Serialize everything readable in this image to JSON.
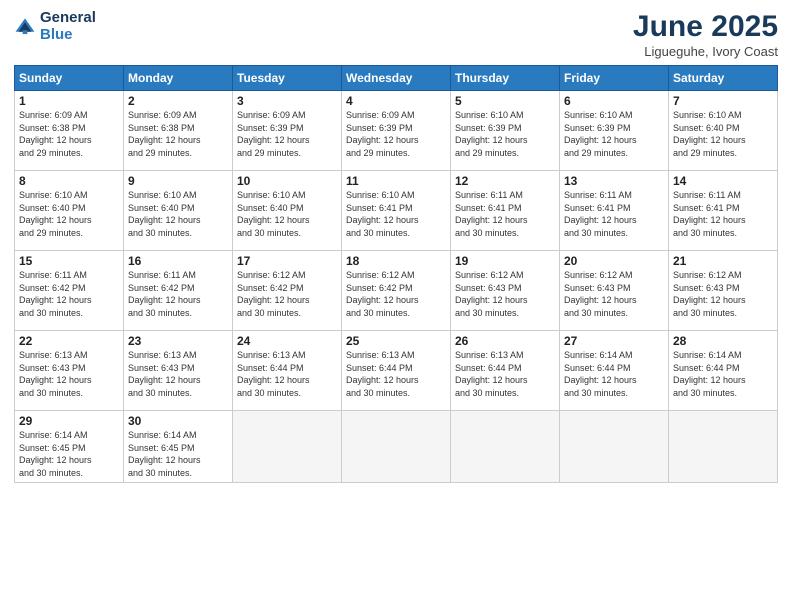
{
  "logo": {
    "line1": "General",
    "line2": "Blue"
  },
  "title": "June 2025",
  "subtitle": "Ligueguhe, Ivory Coast",
  "days_header": [
    "Sunday",
    "Monday",
    "Tuesday",
    "Wednesday",
    "Thursday",
    "Friday",
    "Saturday"
  ],
  "weeks": [
    [
      {
        "day": "1",
        "info": "Sunrise: 6:09 AM\nSunset: 6:38 PM\nDaylight: 12 hours\nand 29 minutes."
      },
      {
        "day": "2",
        "info": "Sunrise: 6:09 AM\nSunset: 6:38 PM\nDaylight: 12 hours\nand 29 minutes."
      },
      {
        "day": "3",
        "info": "Sunrise: 6:09 AM\nSunset: 6:39 PM\nDaylight: 12 hours\nand 29 minutes."
      },
      {
        "day": "4",
        "info": "Sunrise: 6:09 AM\nSunset: 6:39 PM\nDaylight: 12 hours\nand 29 minutes."
      },
      {
        "day": "5",
        "info": "Sunrise: 6:10 AM\nSunset: 6:39 PM\nDaylight: 12 hours\nand 29 minutes."
      },
      {
        "day": "6",
        "info": "Sunrise: 6:10 AM\nSunset: 6:39 PM\nDaylight: 12 hours\nand 29 minutes."
      },
      {
        "day": "7",
        "info": "Sunrise: 6:10 AM\nSunset: 6:40 PM\nDaylight: 12 hours\nand 29 minutes."
      }
    ],
    [
      {
        "day": "8",
        "info": "Sunrise: 6:10 AM\nSunset: 6:40 PM\nDaylight: 12 hours\nand 29 minutes."
      },
      {
        "day": "9",
        "info": "Sunrise: 6:10 AM\nSunset: 6:40 PM\nDaylight: 12 hours\nand 30 minutes."
      },
      {
        "day": "10",
        "info": "Sunrise: 6:10 AM\nSunset: 6:40 PM\nDaylight: 12 hours\nand 30 minutes."
      },
      {
        "day": "11",
        "info": "Sunrise: 6:10 AM\nSunset: 6:41 PM\nDaylight: 12 hours\nand 30 minutes."
      },
      {
        "day": "12",
        "info": "Sunrise: 6:11 AM\nSunset: 6:41 PM\nDaylight: 12 hours\nand 30 minutes."
      },
      {
        "day": "13",
        "info": "Sunrise: 6:11 AM\nSunset: 6:41 PM\nDaylight: 12 hours\nand 30 minutes."
      },
      {
        "day": "14",
        "info": "Sunrise: 6:11 AM\nSunset: 6:41 PM\nDaylight: 12 hours\nand 30 minutes."
      }
    ],
    [
      {
        "day": "15",
        "info": "Sunrise: 6:11 AM\nSunset: 6:42 PM\nDaylight: 12 hours\nand 30 minutes."
      },
      {
        "day": "16",
        "info": "Sunrise: 6:11 AM\nSunset: 6:42 PM\nDaylight: 12 hours\nand 30 minutes."
      },
      {
        "day": "17",
        "info": "Sunrise: 6:12 AM\nSunset: 6:42 PM\nDaylight: 12 hours\nand 30 minutes."
      },
      {
        "day": "18",
        "info": "Sunrise: 6:12 AM\nSunset: 6:42 PM\nDaylight: 12 hours\nand 30 minutes."
      },
      {
        "day": "19",
        "info": "Sunrise: 6:12 AM\nSunset: 6:43 PM\nDaylight: 12 hours\nand 30 minutes."
      },
      {
        "day": "20",
        "info": "Sunrise: 6:12 AM\nSunset: 6:43 PM\nDaylight: 12 hours\nand 30 minutes."
      },
      {
        "day": "21",
        "info": "Sunrise: 6:12 AM\nSunset: 6:43 PM\nDaylight: 12 hours\nand 30 minutes."
      }
    ],
    [
      {
        "day": "22",
        "info": "Sunrise: 6:13 AM\nSunset: 6:43 PM\nDaylight: 12 hours\nand 30 minutes."
      },
      {
        "day": "23",
        "info": "Sunrise: 6:13 AM\nSunset: 6:43 PM\nDaylight: 12 hours\nand 30 minutes."
      },
      {
        "day": "24",
        "info": "Sunrise: 6:13 AM\nSunset: 6:44 PM\nDaylight: 12 hours\nand 30 minutes."
      },
      {
        "day": "25",
        "info": "Sunrise: 6:13 AM\nSunset: 6:44 PM\nDaylight: 12 hours\nand 30 minutes."
      },
      {
        "day": "26",
        "info": "Sunrise: 6:13 AM\nSunset: 6:44 PM\nDaylight: 12 hours\nand 30 minutes."
      },
      {
        "day": "27",
        "info": "Sunrise: 6:14 AM\nSunset: 6:44 PM\nDaylight: 12 hours\nand 30 minutes."
      },
      {
        "day": "28",
        "info": "Sunrise: 6:14 AM\nSunset: 6:44 PM\nDaylight: 12 hours\nand 30 minutes."
      }
    ],
    [
      {
        "day": "29",
        "info": "Sunrise: 6:14 AM\nSunset: 6:45 PM\nDaylight: 12 hours\nand 30 minutes."
      },
      {
        "day": "30",
        "info": "Sunrise: 6:14 AM\nSunset: 6:45 PM\nDaylight: 12 hours\nand 30 minutes."
      },
      {
        "day": "",
        "info": ""
      },
      {
        "day": "",
        "info": ""
      },
      {
        "day": "",
        "info": ""
      },
      {
        "day": "",
        "info": ""
      },
      {
        "day": "",
        "info": ""
      }
    ]
  ]
}
